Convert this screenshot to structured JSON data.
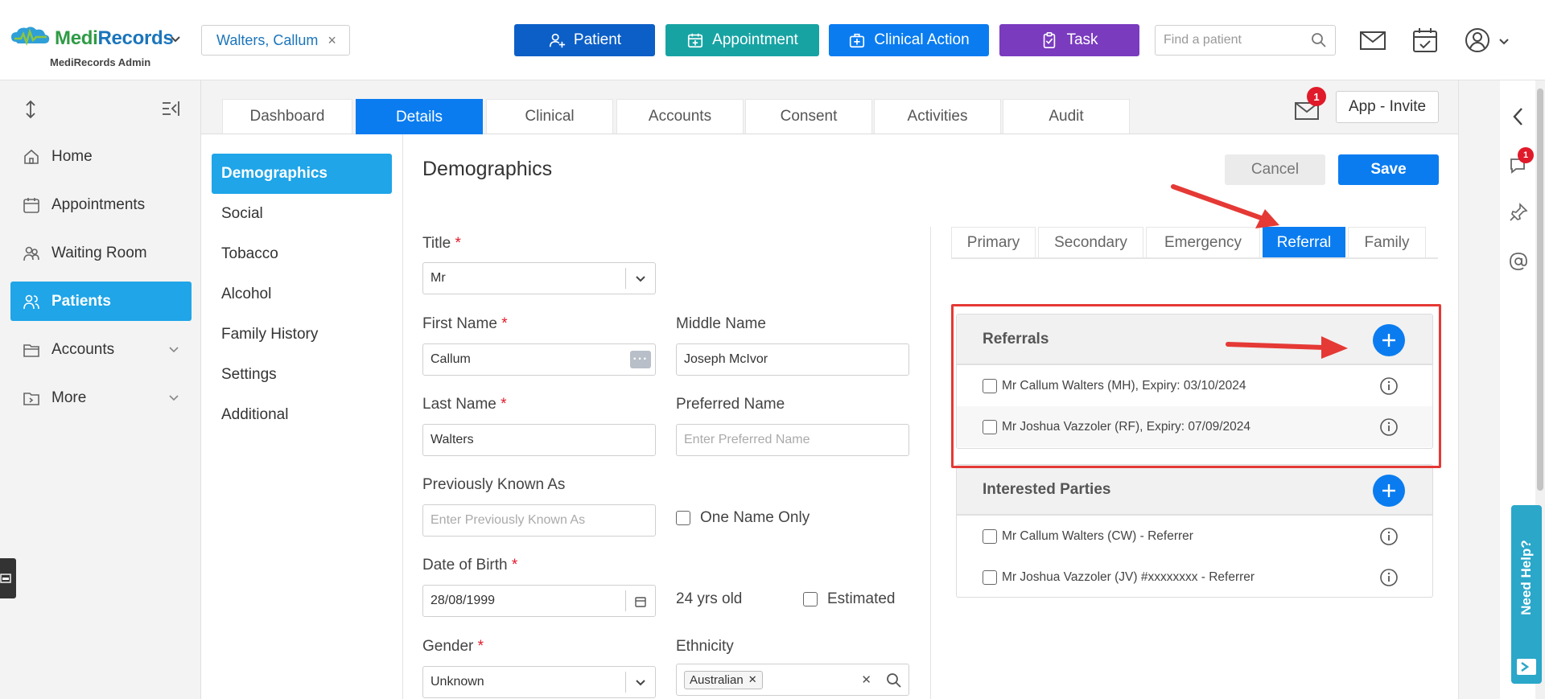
{
  "header": {
    "logo_part1": "Medi",
    "logo_part2": "Records",
    "logo_sub": "MediRecords Admin",
    "patient_chip": "Walters, Callum",
    "patient_chip_close": "×",
    "buttons": {
      "patient": "Patient",
      "appointment": "Appointment",
      "clinical_action": "Clinical Action",
      "task": "Task"
    },
    "search_placeholder": "Find a patient",
    "colors": {
      "patient": "#0c5fc7",
      "appointment": "#18a3a3",
      "clinical_action": "#0a7cf0",
      "task": "#7a3bbf"
    }
  },
  "sidebar": {
    "items": [
      {
        "label": "Home",
        "icon": "home-icon"
      },
      {
        "label": "Appointments",
        "icon": "calendar-icon"
      },
      {
        "label": "Waiting Room",
        "icon": "people-icon"
      },
      {
        "label": "Patients",
        "icon": "patients-icon",
        "active": true
      },
      {
        "label": "Accounts",
        "icon": "folder-icon"
      },
      {
        "label": "More",
        "icon": "more-icon"
      }
    ]
  },
  "tabs": [
    "Dashboard",
    "Details",
    "Clinical",
    "Accounts",
    "Consent",
    "Activities",
    "Audit"
  ],
  "message_badge": "1",
  "invite_label": "App - Invite",
  "subnav": [
    "Demographics",
    "Social",
    "Tobacco",
    "Alcohol",
    "Family History",
    "Settings",
    "Additional"
  ],
  "form": {
    "title": "Demographics",
    "cancel": "Cancel",
    "save": "Save",
    "title_label": "Title",
    "title_value": "Mr",
    "first_name_label": "First Name",
    "first_name_value": "Callum",
    "middle_name_label": "Middle Name",
    "middle_name_value": "Joseph McIvor",
    "last_name_label": "Last Name",
    "last_name_value": "Walters",
    "preferred_name_label": "Preferred Name",
    "preferred_name_placeholder": "Enter Preferred Name",
    "prev_known_label": "Previously Known As",
    "prev_known_placeholder": "Enter Previously Known As",
    "one_name_only": "One Name Only",
    "dob_label": "Date of Birth",
    "dob_value": "28/08/1999",
    "age": "24 yrs old",
    "estimated": "Estimated",
    "gender_label": "Gender",
    "gender_value": "Unknown",
    "ethnicity_label": "Ethnicity",
    "ethnicity_tag": "Australian",
    "required_mark": "*"
  },
  "contact_tabs": [
    "Primary",
    "Secondary",
    "Emergency",
    "Referral",
    "Family"
  ],
  "referrals": {
    "title": "Referrals",
    "rows": [
      "Mr Callum Walters (MH), Expiry: 03/10/2024",
      "Mr Joshua Vazzoler (RF), Expiry: 07/09/2024"
    ]
  },
  "interested_parties": {
    "title": "Interested Parties",
    "rows": [
      "Mr Callum Walters (CW) - Referrer",
      "Mr Joshua Vazzoler (JV) #xxxxxxxx - Referrer"
    ]
  },
  "right_rail_badge": "1",
  "help_label": "Need Help?"
}
